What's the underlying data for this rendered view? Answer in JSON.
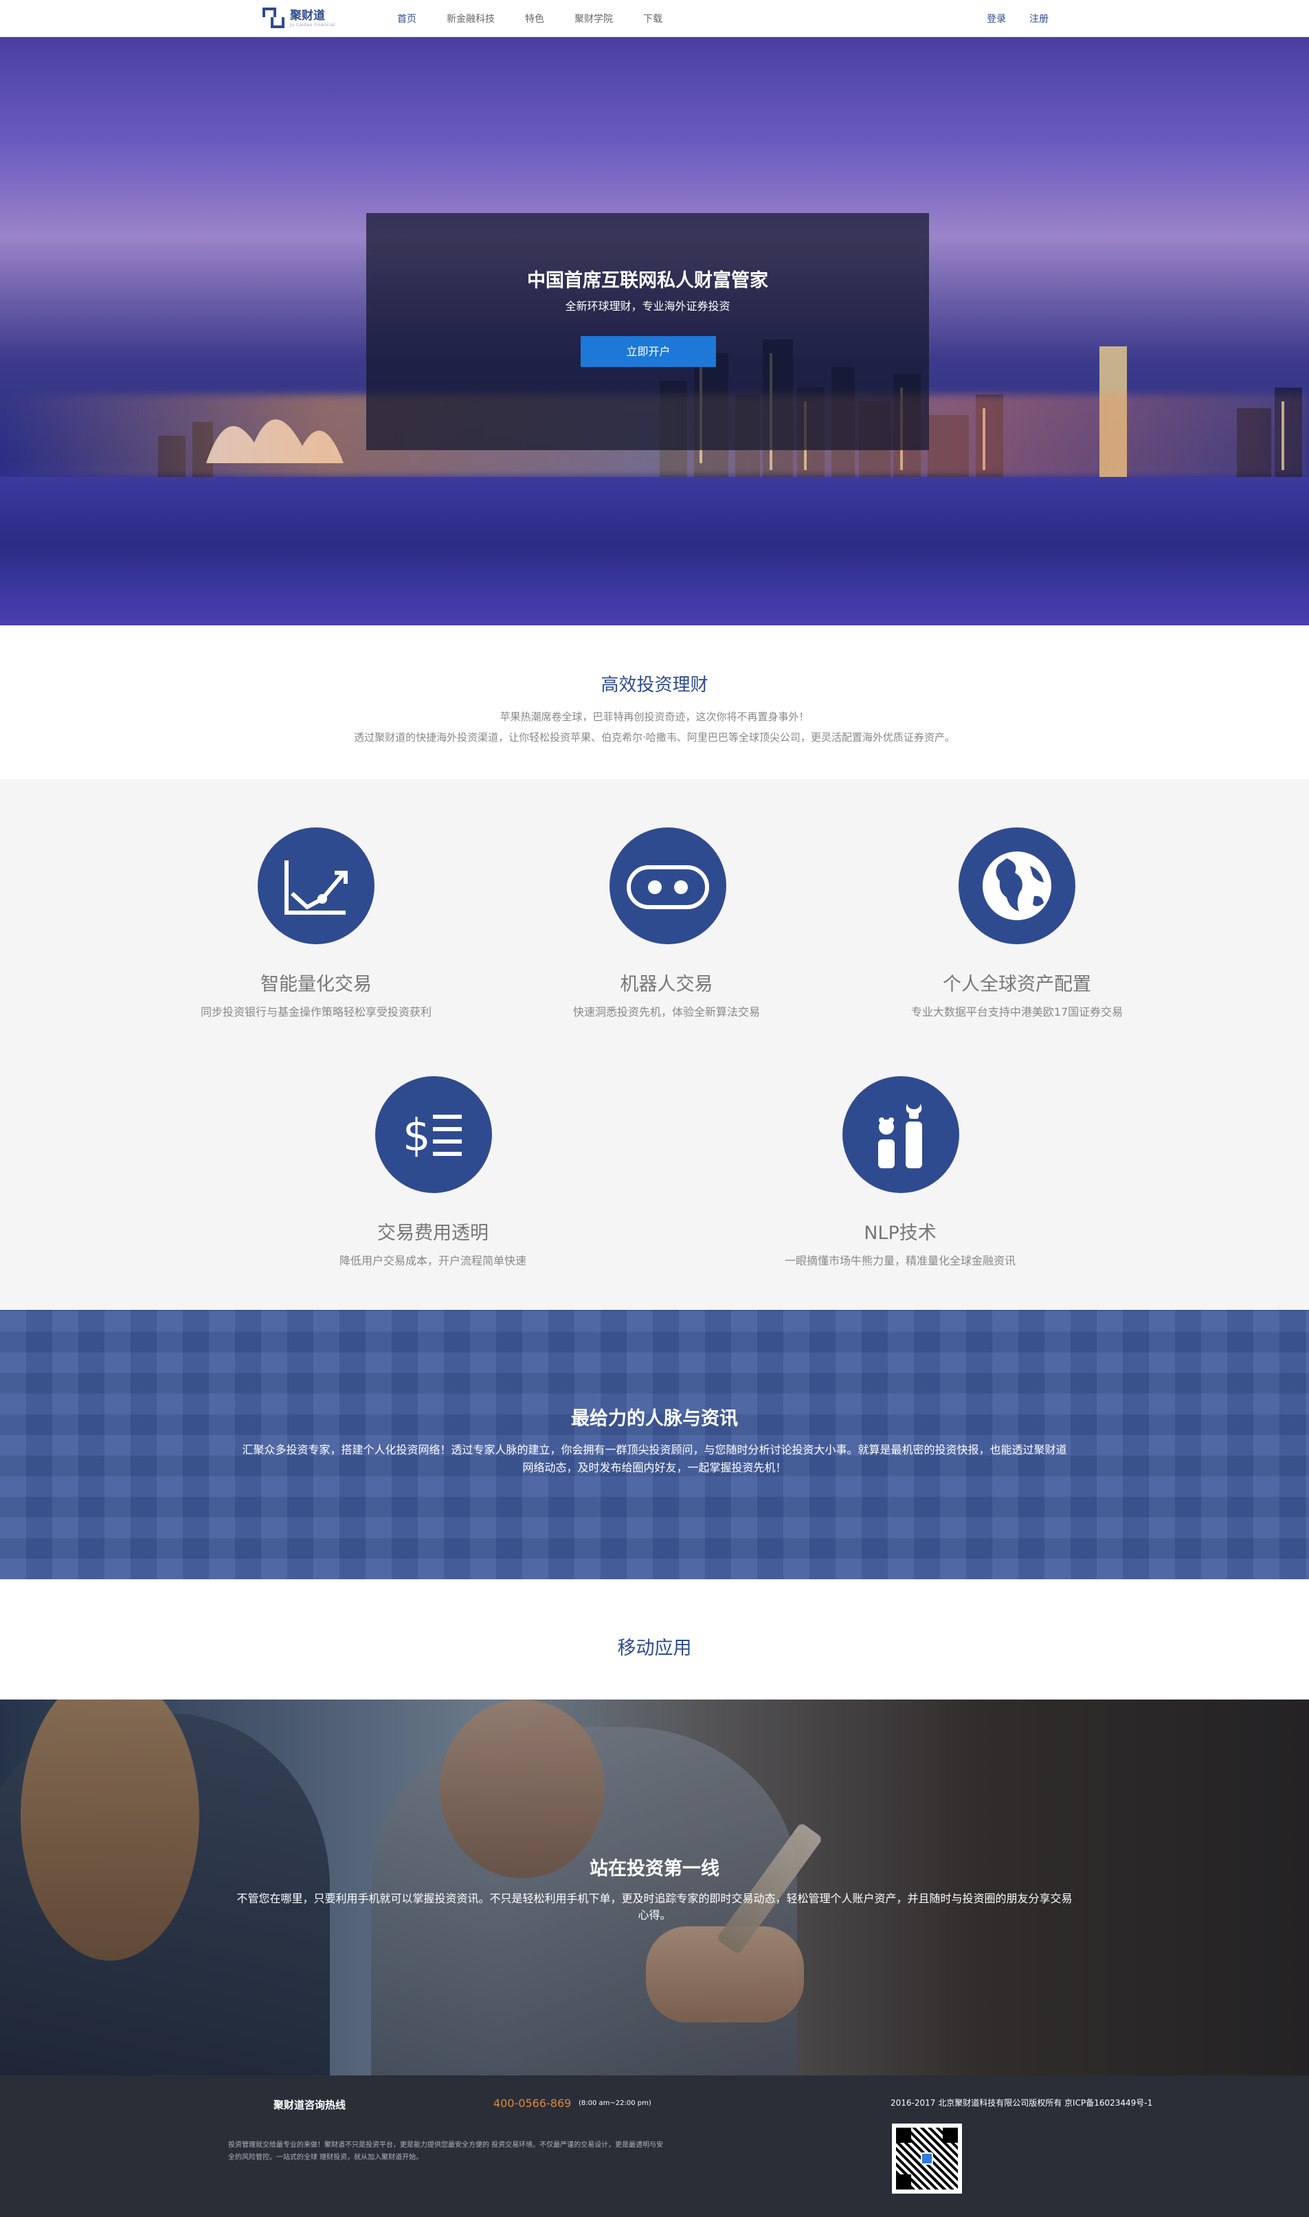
{
  "nav": {
    "logo_name": "聚财道",
    "logo_sub": "Ju Caidao Financial",
    "links": [
      "首页",
      "新金融科技",
      "特色",
      "聚财学院",
      "下载"
    ],
    "login": "登录",
    "register": "注册"
  },
  "hero": {
    "title": "中国首席互联网私人财富管家",
    "subtitle": "全新环球理财，专业海外证券投资",
    "cta": "立即开户"
  },
  "intro": {
    "title": "高效投资理财",
    "line1": "苹果热潮席卷全球，巴菲特再创投资奇迹，这次你将不再置身事外！",
    "line2": "透过聚财道的快捷海外投资渠道，让你轻松投资苹果、伯克希尔·哈撒韦、阿里巴巴等全球顶尖公司，更灵活配置海外优质证券资产。"
  },
  "features": [
    {
      "icon": "line-chart-icon",
      "title": "智能量化交易",
      "desc": "同步投资银行与基金操作策略轻松享受投资获利"
    },
    {
      "icon": "robot-icon",
      "title": "机器人交易",
      "desc": "快速洞悉投资先机，体验全新算法交易"
    },
    {
      "icon": "globe-icon",
      "title": "个人全球资产配置",
      "desc": "专业大数据平台支持中港美欧17国证券交易"
    },
    {
      "icon": "dollar-list-icon",
      "title": "交易费用透明",
      "desc": "降低用户交易成本，开户流程简单快速"
    },
    {
      "icon": "bull-bear-icon",
      "title": "NLP技术",
      "desc": "一眼摘懂市场牛熊力量，精准量化全球金融资讯"
    }
  ],
  "network": {
    "title": "最给力的人脉与资讯",
    "line1": "汇聚众多投资专家，搭建个人化投资网络！透过专家人脉的建立，你会拥有一群顶尖投资顾问，与您随时分析讨论投资大小事。就算是最机密的投资快报，也能透过聚财道",
    "line2": "网络动态，及时发布给圈内好友，一起掌握投资先机！"
  },
  "mobile": {
    "title": "移动应用"
  },
  "photo": {
    "title": "站在投资第一线",
    "line1": "不管您在哪里，只要利用手机就可以掌握投资资讯。不只是轻松利用手机下单，更及时追踪专家的即时交易动态，轻松管理个人账户资产，并且随时与投资圈的朋友分享交易",
    "line2": "心得。"
  },
  "footer": {
    "hotline_label": "聚财道咨询热线",
    "phone": "400-0566-869",
    "hours": "(8:00 am~22:00 pm)",
    "copyright": "2016-2017 北京聚财道科技有限公司版权所有 京ICP备16023449号-1",
    "desc1": "投资管理就交给最专业的来做！聚财道不只是投资平台，更是能力提供您最安全方便的 投资交易环境。不仅最严谨的交易设计，更是最透明与安",
    "desc2": "全的风险管控。一站式的全球 理财投资，就从加入聚财道开始。"
  },
  "colors": {
    "brand": "#2f4b8f",
    "cta": "#1d78d8",
    "phone": "#e0883a",
    "footer_bg": "#2a2e37"
  }
}
